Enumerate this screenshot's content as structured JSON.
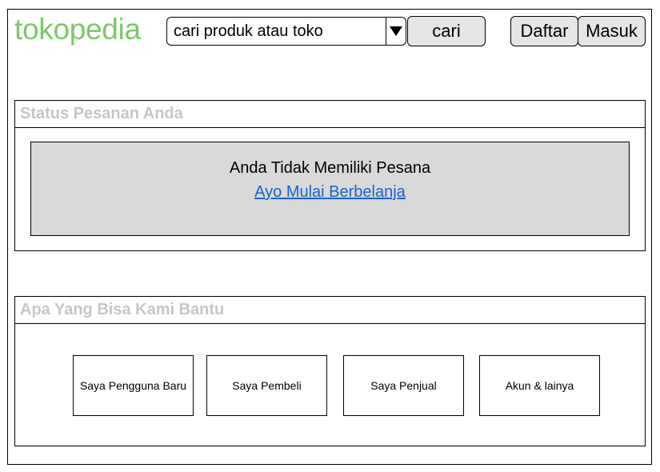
{
  "header": {
    "logo": "tokopedia",
    "search": {
      "placeholder": "cari produk atau toko"
    },
    "search_button": "cari",
    "register_button": "Daftar",
    "login_button": "Masuk"
  },
  "order_status": {
    "title": "Status Pesanan Anda",
    "empty_message": "Anda Tidak Memiliki Pesana",
    "cta_link": "Ayo Mulai Berbelanja"
  },
  "help": {
    "title": "Apa Yang Bisa Kami Bantu",
    "cards": [
      {
        "label": "Saya Pengguna Baru"
      },
      {
        "label": "Saya Pembeli"
      },
      {
        "label": "Saya Penjual"
      },
      {
        "label": "Akun & lainya"
      }
    ]
  },
  "icons": {
    "dropdown": "triangle-down-icon"
  },
  "colors": {
    "logo": "#7dc76a",
    "link": "#1a62d1",
    "panel_title": "#c6c6c6",
    "button_bg": "#e6e6e6",
    "empty_bg": "#d9d9d9"
  }
}
